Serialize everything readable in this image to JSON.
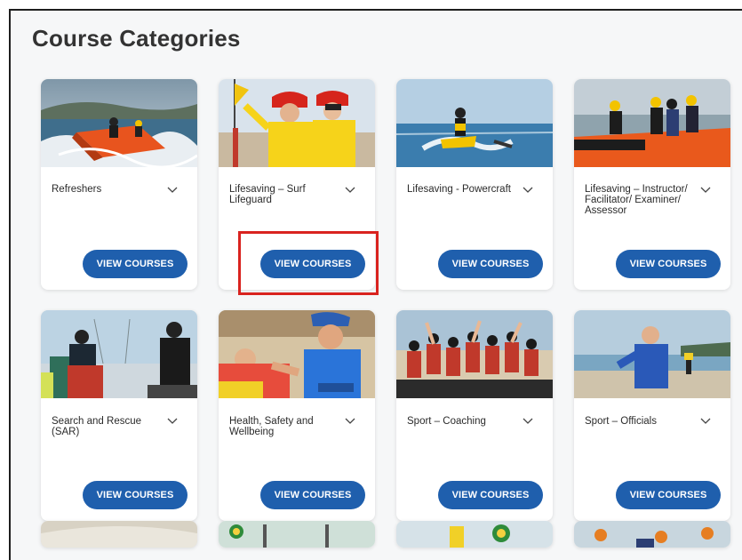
{
  "page": {
    "title": "Course Categories"
  },
  "button_label": "VIEW COURSES",
  "accent_color": "#1f5fad",
  "highlight_color": "#d9231f",
  "categories": [
    {
      "title": "Refreshers",
      "image": "ocean-rescue-boat"
    },
    {
      "title": "Lifesaving – Surf Lifeguard",
      "image": "lifeguards-flag"
    },
    {
      "title": "Lifesaving - Powercraft",
      "image": "jetski-rescue"
    },
    {
      "title": "Lifesaving – Instructor/ Facilitator/ Examiner/ Assessor",
      "image": "surf-rescue-boat"
    },
    {
      "title": "Search and Rescue (SAR)",
      "image": "sar-team-window"
    },
    {
      "title": "Health, Safety and Wellbeing",
      "image": "surf-official-first-aid"
    },
    {
      "title": "Sport – Coaching",
      "image": "youth-team-cheering"
    },
    {
      "title": "Sport – Officials",
      "image": "official-on-beach"
    }
  ]
}
